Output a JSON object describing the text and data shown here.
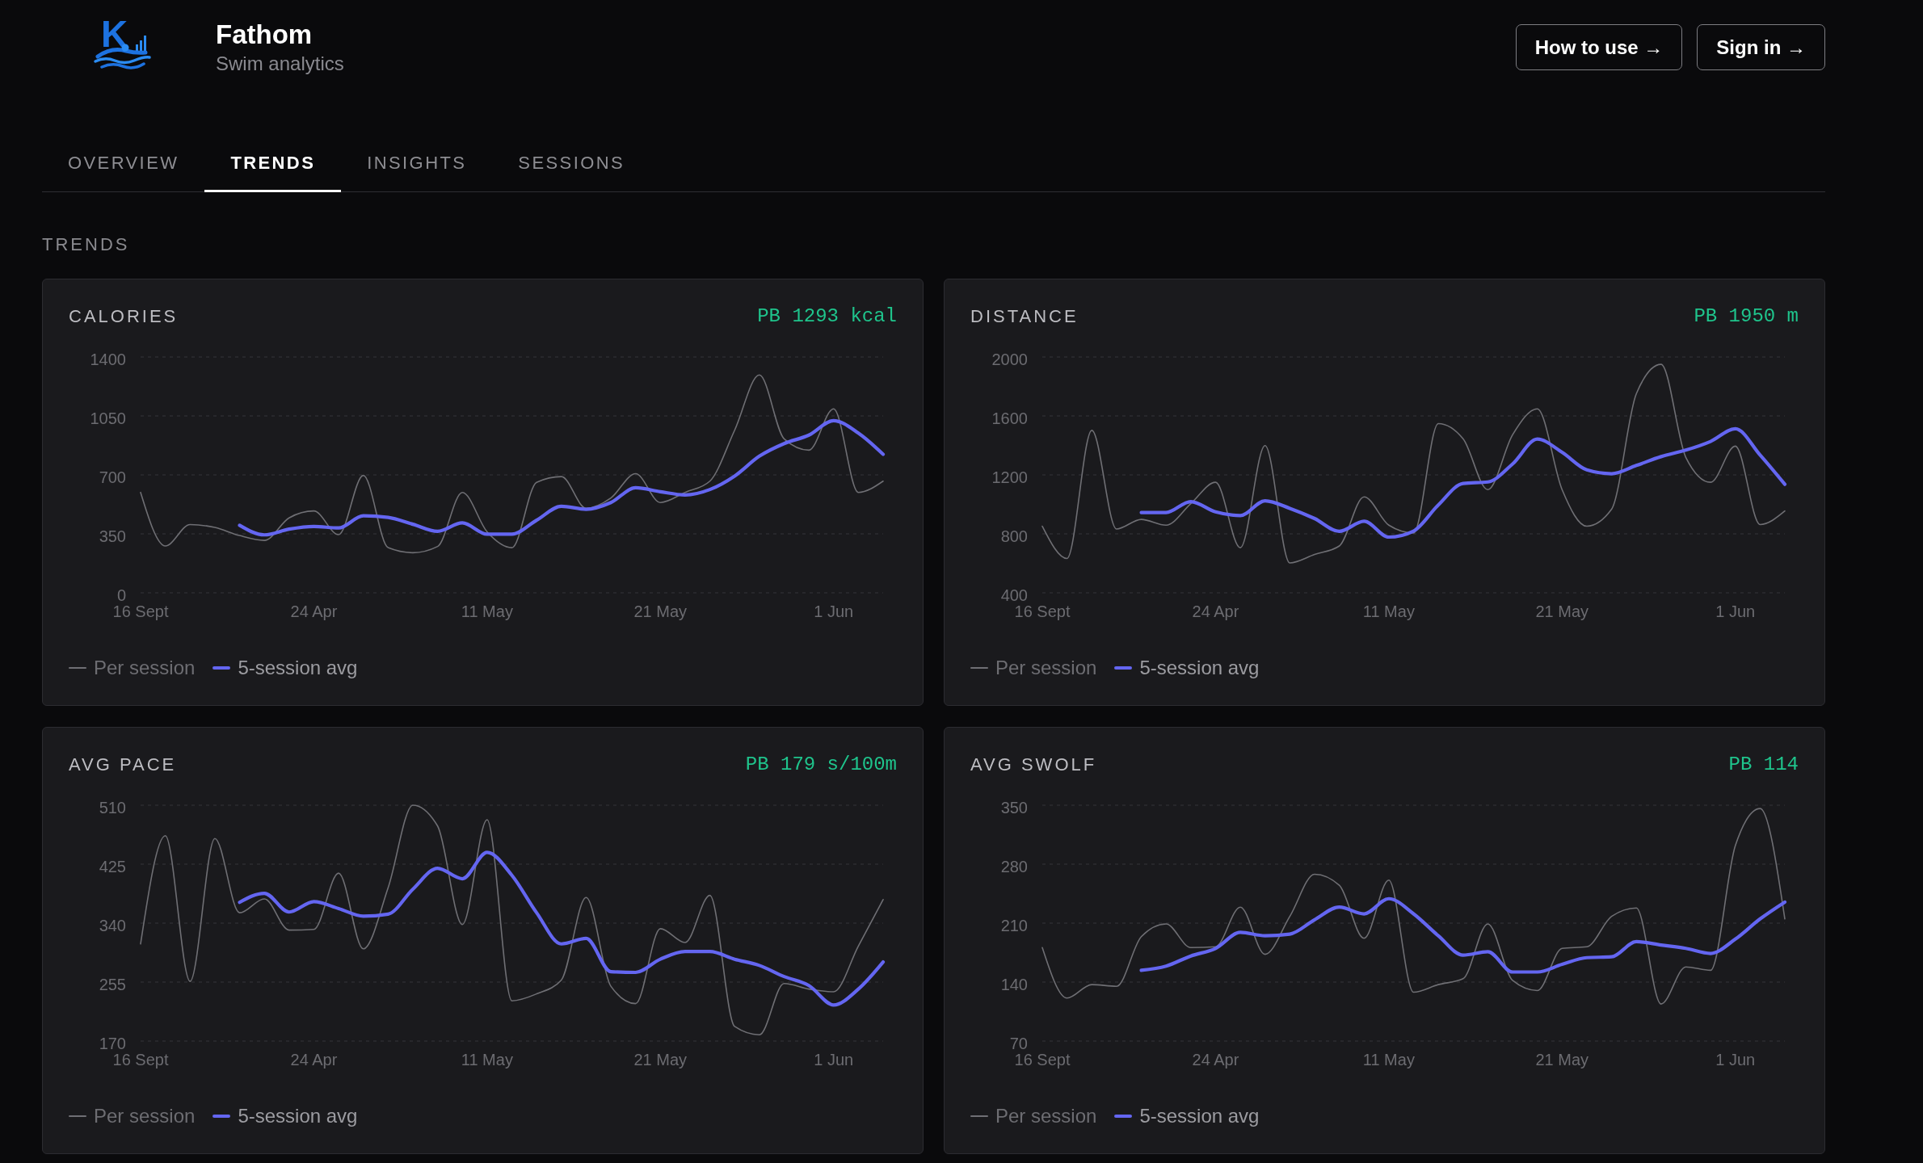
{
  "brand": {
    "logo_text": "K",
    "name": "Fathom",
    "tagline": "Swim analytics"
  },
  "header_buttons": [
    "How to use →",
    "Sign in →"
  ],
  "tabs": [
    {
      "label": "OVERVIEW",
      "selected": false
    },
    {
      "label": "TRENDS",
      "selected": true
    },
    {
      "label": "INSIGHTS",
      "selected": false
    },
    {
      "label": "SESSIONS",
      "selected": false
    }
  ],
  "section": {
    "title": "TRENDS"
  },
  "charts": [
    {
      "title": "CALORIES",
      "personal_best": "PB 1293 kcal",
      "chart_data": {
        "type": "line",
        "categories": [
          "16 Sept",
          null,
          null,
          null,
          null,
          null,
          null,
          "24 Apr",
          null,
          null,
          null,
          null,
          null,
          null,
          "11 May",
          null,
          null,
          null,
          null,
          null,
          null,
          "21 May",
          null,
          null,
          null,
          null,
          null,
          null,
          "1 Jun",
          null,
          null
        ],
        "ylim": [
          0,
          1400
        ],
        "yticks": [
          0,
          350,
          700,
          1050,
          1400
        ],
        "grid": true,
        "legend": "bottom",
        "series": [
          {
            "name": "Per session",
            "color": "#6f6f74",
            "values": [
              596,
              278,
              405,
              388,
              340,
              311,
              445,
              486,
              345,
              697,
              268,
              238,
              275,
              596,
              362,
              268,
              656,
              690,
              502,
              563,
              707,
              536,
              596,
              663,
              965,
              1293,
              914,
              847,
              1092,
              596,
              663
            ]
          },
          {
            "name": "5-session avg",
            "color": "#6466f1",
            "values": [
              null,
              null,
              null,
              null,
              401,
              344,
              378,
              394,
              385,
              457,
              448,
              407,
              365,
              415,
              348,
              348,
              431,
              514,
              496,
              536,
              624,
              600,
              581,
              613,
              693,
              811,
              886,
              936,
              1022,
              948,
              822
            ]
          }
        ]
      }
    },
    {
      "title": "DISTANCE",
      "personal_best": "PB 1950 m",
      "chart_data": {
        "type": "line",
        "categories": [
          "16 Sept",
          null,
          null,
          null,
          null,
          null,
          null,
          "24 Apr",
          null,
          null,
          null,
          null,
          null,
          null,
          "11 May",
          null,
          null,
          null,
          null,
          null,
          null,
          "21 May",
          null,
          null,
          null,
          null,
          null,
          null,
          "1 Jun",
          null,
          null
        ],
        "ylim": [
          400,
          2000
        ],
        "yticks": [
          400,
          800,
          1200,
          1600,
          2000
        ],
        "grid": true,
        "legend": "bottom",
        "series": [
          {
            "name": "Per session",
            "color": "#6f6f74",
            "values": [
              852,
              633,
              1502,
              833,
              898,
              859,
              1005,
              1150,
              706,
              1399,
              603,
              660,
              718,
              1051,
              859,
              806,
              1548,
              1445,
              1100,
              1472,
              1648,
              1100,
              852,
              967,
              1751,
              1950,
              1319,
              1150,
              1395,
              863,
              955
            ]
          },
          {
            "name": "5-session avg",
            "color": "#6466f1",
            "values": [
              null,
              null,
              null,
              null,
              944,
              945,
              1019,
              949,
              924,
              1024,
              973,
              904,
              817,
              886,
              778,
              819,
              996,
              1142,
              1152,
              1274,
              1443,
              1353,
              1234,
              1208,
              1264,
              1324,
              1368,
              1427,
              1513,
              1335,
              1136
            ]
          }
        ]
      }
    },
    {
      "title": "AVG PACE",
      "personal_best": "PB 179 s/100m",
      "chart_data": {
        "type": "line",
        "categories": [
          "16 Sept",
          null,
          null,
          null,
          null,
          null,
          null,
          "24 Apr",
          null,
          null,
          null,
          null,
          null,
          null,
          "11 May",
          null,
          null,
          null,
          null,
          null,
          null,
          "21 May",
          null,
          null,
          null,
          null,
          null,
          null,
          "1 Jun",
          null,
          null
        ],
        "ylim": [
          170,
          510
        ],
        "yticks": [
          170,
          255,
          340,
          425,
          510
        ],
        "grid": true,
        "legend": "bottom",
        "series": [
          {
            "name": "Per session",
            "color": "#6f6f74",
            "values": [
              310,
              466,
              256,
              462,
              355,
              375,
              330,
              331,
              412,
              303,
              391,
              510,
              480,
              338,
              489,
              228,
              238,
              258,
              377,
              249,
              224,
              332,
              312,
              380,
              191,
              179,
              253,
              245,
              241,
              307,
              374
            ]
          },
          {
            "name": "5-session avg",
            "color": "#6466f1",
            "values": [
              null,
              null,
              null,
              null,
              370,
              383,
              356,
              371,
              361,
              350,
              353,
              389,
              419,
              404,
              442,
              409,
              355,
              310,
              318,
              270,
              269,
              288,
              299,
              299,
              288,
              279,
              263,
              250,
              222,
              245,
              284
            ]
          }
        ]
      }
    },
    {
      "title": "AVG SWOLF",
      "personal_best": "PB 114",
      "chart_data": {
        "type": "line",
        "categories": [
          "16 Sept",
          null,
          null,
          null,
          null,
          null,
          null,
          "24 Apr",
          null,
          null,
          null,
          null,
          null,
          null,
          "11 May",
          null,
          null,
          null,
          null,
          null,
          null,
          "21 May",
          null,
          null,
          null,
          null,
          null,
          null,
          "1 Jun",
          null,
          null
        ],
        "ylim": [
          70,
          350
        ],
        "yticks": [
          70,
          140,
          210,
          280,
          350
        ],
        "grid": true,
        "legend": "bottom",
        "series": [
          {
            "name": "Per session",
            "color": "#6f6f74",
            "values": [
              181,
              121,
              137,
              135,
              194,
              209,
              181,
              182,
              229,
              173,
              218,
              268,
              255,
              192,
              261,
              128,
              137,
              144,
              209,
              142,
              130,
              180,
              182,
              218,
              228,
              114,
              158,
              154,
              302,
              346,
              215
            ]
          },
          {
            "name": "5-session avg",
            "color": "#6466f1",
            "values": [
              null,
              null,
              null,
              null,
              154,
              159,
              171,
              180,
              199,
              195,
              197,
              214,
              229,
              221,
              239,
              221,
              195,
              172,
              176,
              152,
              152,
              161,
              169,
              170,
              188,
              184,
              180,
              174,
              191,
              215,
              235
            ]
          }
        ]
      }
    }
  ]
}
